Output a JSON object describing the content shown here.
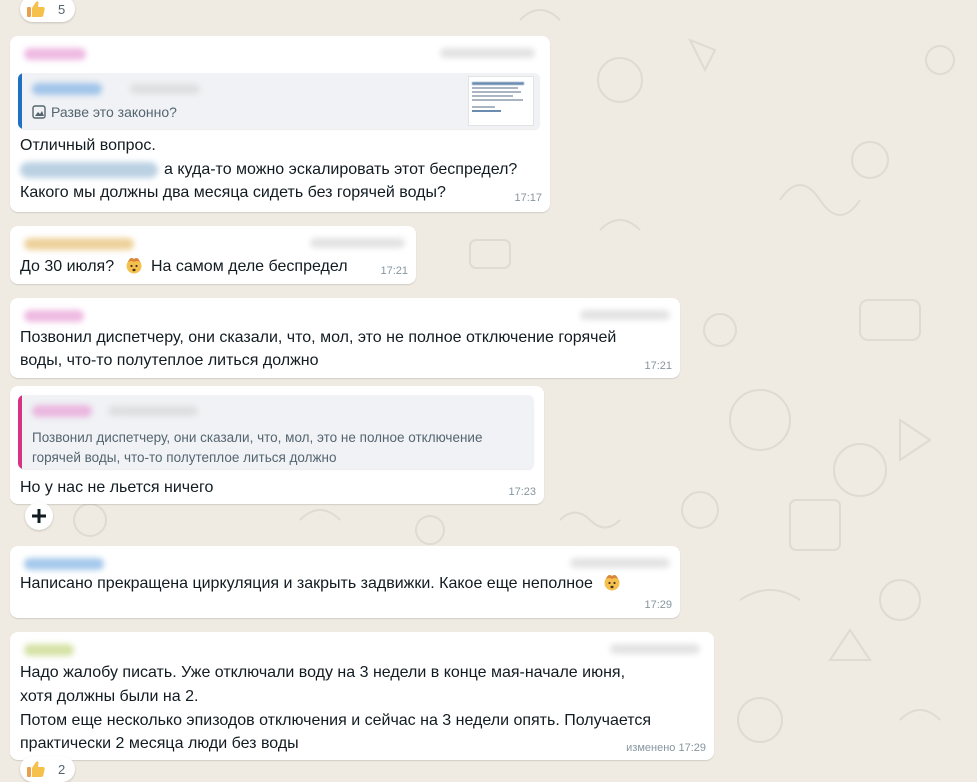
{
  "top_reaction": {
    "count": "5",
    "icon": "thumbs-up-icon"
  },
  "bottom_reaction": {
    "count": "2",
    "icon": "thumbs-up-icon"
  },
  "messages": [
    {
      "quote_text": "Разве это законно?",
      "lines": [
        "Отличный вопрос.",
        "а куда-то можно эскалировать этот беспредел?",
        "Какого мы должны два месяца сидеть без горячей воды?"
      ],
      "time": "17:17"
    },
    {
      "text": "До 30 июля?",
      "text_after": "На самом деле беспредел",
      "time": "17:21"
    },
    {
      "lines": [
        "Позвонил диспетчеру, они сказали, что, мол, это не полное отключение горячей",
        "воды, что-то полутеплое литься должно"
      ],
      "time": "17:21"
    },
    {
      "quote_lines": [
        "Позвонил диспетчеру, они сказали, что, мол, это не полное отключение",
        "горячей воды, что-то полутеплое литься должно"
      ],
      "text": "Но у нас не льется ничего",
      "time": "17:23"
    },
    {
      "text": "Написано прекращена циркуляция и закрыть задвижки. Какое еще неполное",
      "time": "17:29"
    },
    {
      "lines": [
        "Надо жалобу писать. Уже отключали воду на 3 недели в конце мая-начале июня,",
        "хотя должны были на 2.",
        "Потом еще несколько эпизодов отключения и сейчас на 3 недели опять. Получается",
        "практически 2 месяца люди без воды"
      ],
      "time": "изменено 17:29"
    }
  ],
  "colors": {
    "chat_background": "#efeae2",
    "bubble": "#ffffff",
    "quote_bar_blue": "#1f6fc5",
    "quote_bar_pink": "#d63384",
    "timestamp": "#8696a0"
  }
}
